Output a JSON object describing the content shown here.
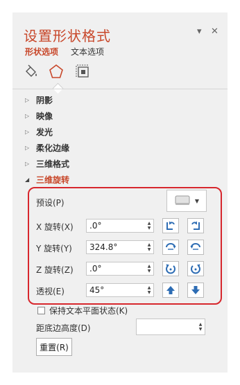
{
  "header": {
    "title": "设置形状格式",
    "dropdown_glyph": "▾",
    "close_glyph": "✕"
  },
  "tabs": [
    {
      "label": "形状选项",
      "active": true
    },
    {
      "label": "文本选项",
      "active": false
    }
  ],
  "category_icons": [
    "fill-line-icon",
    "effects-pentagon-icon",
    "size-properties-icon"
  ],
  "sections": [
    {
      "label": "阴影",
      "expanded": false
    },
    {
      "label": "映像",
      "expanded": false
    },
    {
      "label": "发光",
      "expanded": false
    },
    {
      "label": "柔化边缘",
      "expanded": false
    },
    {
      "label": "三维格式",
      "expanded": false
    },
    {
      "label": "三维旋转",
      "expanded": true
    }
  ],
  "rotation": {
    "preset_label": "预设(P)",
    "rows": [
      {
        "label": "X 旋转(X)",
        "value": ".0°",
        "buttons": [
          "rotate-left-icon",
          "rotate-right-icon"
        ]
      },
      {
        "label": "Y 旋转(Y)",
        "value": "324.8°",
        "buttons": [
          "rotate-up-icon",
          "rotate-down-icon"
        ]
      },
      {
        "label": "Z 旋转(Z)",
        "value": ".0°",
        "buttons": [
          "rotate-counterclockwise-icon",
          "rotate-clockwise-icon"
        ]
      },
      {
        "label": "透视(E)",
        "value": "45°",
        "buttons": [
          "narrow-view-icon",
          "widen-view-icon"
        ]
      }
    ]
  },
  "keep_flat_label": "保持文本平面状态(K)",
  "keep_flat_checked": false,
  "distance_label": "距底边高度(D)",
  "distance_value": "",
  "reset_label": "重置(R)",
  "colors": {
    "accent": "#c8472a",
    "highlight_border": "#d7262c",
    "icon_blue": "#2e6db4"
  }
}
